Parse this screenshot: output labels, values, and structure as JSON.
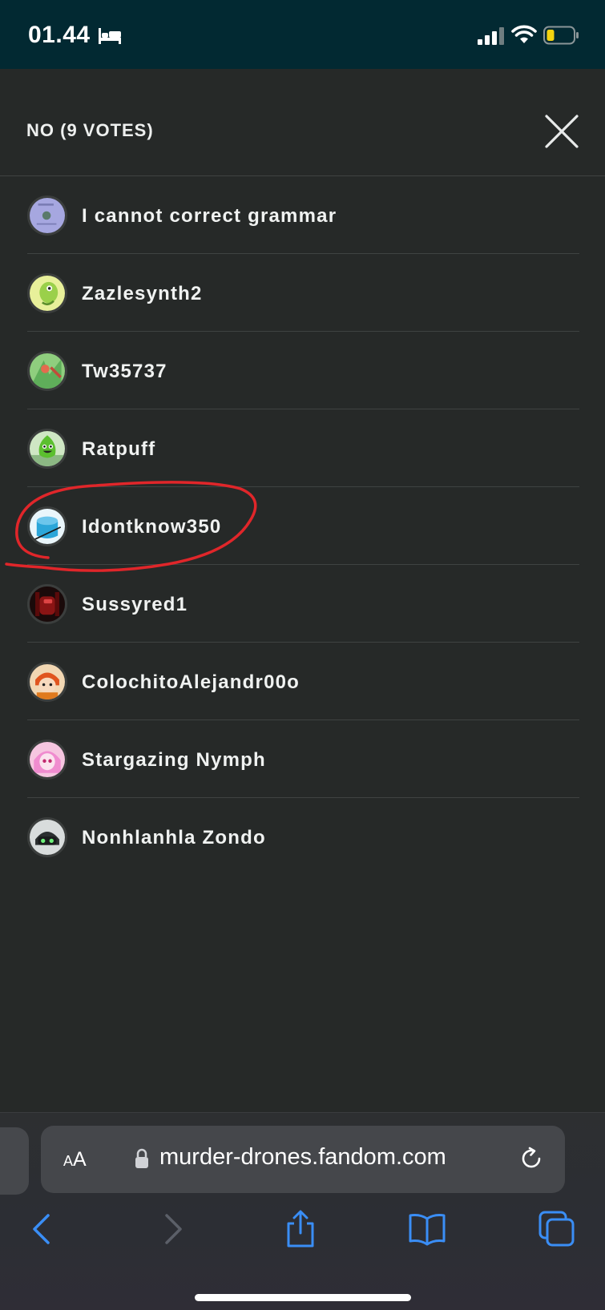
{
  "status_bar": {
    "time": "01.44",
    "icons": [
      "bed-icon",
      "cellular-signal-icon",
      "wifi-icon",
      "battery-low-icon"
    ],
    "battery_color": "#f5d30f"
  },
  "modal": {
    "title": "NO (9 VOTES)",
    "close_icon": "close-icon"
  },
  "voters": [
    {
      "name": "I cannot correct grammar"
    },
    {
      "name": "Zazlesynth2"
    },
    {
      "name": "Tw35737"
    },
    {
      "name": "Ratpuff"
    },
    {
      "name": "Idontknow350"
    },
    {
      "name": "Sussyred1"
    },
    {
      "name": "ColochitoAlejandr00o"
    },
    {
      "name": "Stargazing Nymph"
    },
    {
      "name": "Nonhlanhla Zondo"
    }
  ],
  "annotation": {
    "type": "hand-drawn circle",
    "color": "#e0262a",
    "target": "Idontknow350"
  },
  "browser": {
    "text_size_label_small": "A",
    "text_size_label_large": "A",
    "url": "murder-drones.fandom.com",
    "toolbar_icons": [
      "back-icon",
      "forward-icon",
      "share-icon",
      "bookmarks-icon",
      "tabs-icon"
    ],
    "accent_color": "#3a8ef6"
  }
}
